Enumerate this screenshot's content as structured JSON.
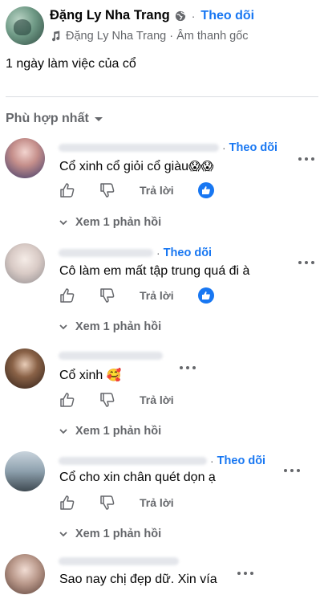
{
  "post": {
    "author": "Đặng Ly Nha Trang",
    "follow": "Theo dõi",
    "audio": "Đặng Ly Nha Trang · Âm thanh gốc",
    "caption": "1 ngày làm việc của cổ"
  },
  "sort": {
    "label": "Phù hợp nhất"
  },
  "comments": [
    {
      "follow": "Theo dõi",
      "text": "Cổ xinh cổ giỏi cổ giàu",
      "emoji": "😱😱",
      "reply": "Trả lời",
      "view_replies": "Xem 1 phản hồi",
      "has_reaction": true
    },
    {
      "follow": "Theo dõi",
      "text": "Cô làm em mất tập trung quá đi à",
      "emoji": "",
      "reply": "Trả lời",
      "view_replies": "Xem 1 phản hồi",
      "has_reaction": true
    },
    {
      "follow": "",
      "text": "Cổ xinh",
      "emoji": "🥰",
      "reply": "Trả lời",
      "view_replies": "Xem 1 phản hồi",
      "has_reaction": false
    },
    {
      "follow": "Theo dõi",
      "text": "Cổ cho xin chân quét dọn ạ",
      "emoji": "",
      "reply": "Trả lời",
      "view_replies": "Xem 1 phản hồi",
      "has_reaction": false
    },
    {
      "follow": "",
      "text": "Sao nay chị đẹp dữ. Xin vía",
      "emoji": "",
      "reply": "",
      "view_replies": "",
      "has_reaction": false
    }
  ],
  "colors": {
    "accent": "#1877f2",
    "secondary_text": "#65676b"
  }
}
